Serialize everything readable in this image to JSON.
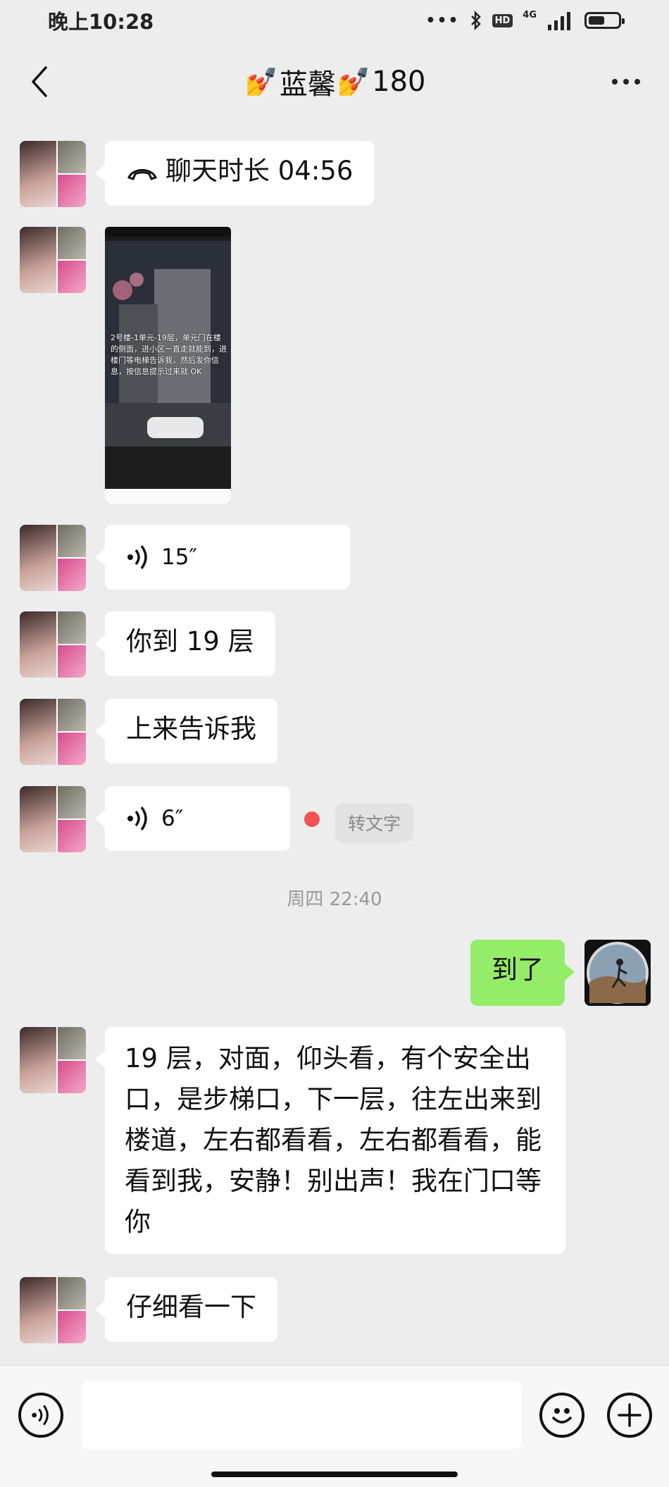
{
  "status_bar": {
    "time": "晚上10:28",
    "dots": "•••",
    "hd": "HD",
    "network": "4G",
    "battery_level": 0.55
  },
  "header": {
    "title_pre_icon": "nail-polish-icon",
    "title_name": "蓝馨",
    "title_post_icon": "nail-polish-icon",
    "title_suffix": "180",
    "back_icon": "chevron-left-icon",
    "more_icon": "more-dots-icon"
  },
  "messages": [
    {
      "type": "call",
      "side": "left",
      "icon": "phone-hangup-icon",
      "text": "聊天时长 04:56"
    },
    {
      "type": "image",
      "side": "left",
      "image_text": "2号楼-1单元-19层，单元门在楼的侧面，进小区一直走就能到，进楼门等电梯告诉我，然后发你信息，按信息提示过来就 OK"
    },
    {
      "type": "voice",
      "side": "left",
      "icon": "voice-icon",
      "duration": "15″"
    },
    {
      "type": "text",
      "side": "left",
      "text": "你到 19 层"
    },
    {
      "type": "text",
      "side": "left",
      "text": "上来告诉我"
    },
    {
      "type": "voice",
      "side": "left",
      "icon": "voice-icon",
      "duration": "6″",
      "unread": true,
      "transcribe_label": "转文字"
    },
    {
      "type": "timestamp",
      "text": "周四 22:40"
    },
    {
      "type": "text",
      "side": "right",
      "text": "到了"
    },
    {
      "type": "text",
      "side": "left",
      "text": "19 层，对面，仰头看，有个安全出口，是步梯口，下一层，往左出来到楼道，左右都看看，左右都看看，能看到我，安静！别出声！我在门口等你"
    },
    {
      "type": "text",
      "side": "left",
      "text": "仔细看一下"
    }
  ],
  "input_bar": {
    "voice_icon": "voice-mode-icon",
    "emoji_icon": "emoji-icon",
    "plus_icon": "plus-icon",
    "input_value": ""
  },
  "colors": {
    "background": "#ededed",
    "incoming_bubble": "#ffffff",
    "outgoing_bubble": "#95ec69",
    "unread_dot": "#f25353"
  }
}
